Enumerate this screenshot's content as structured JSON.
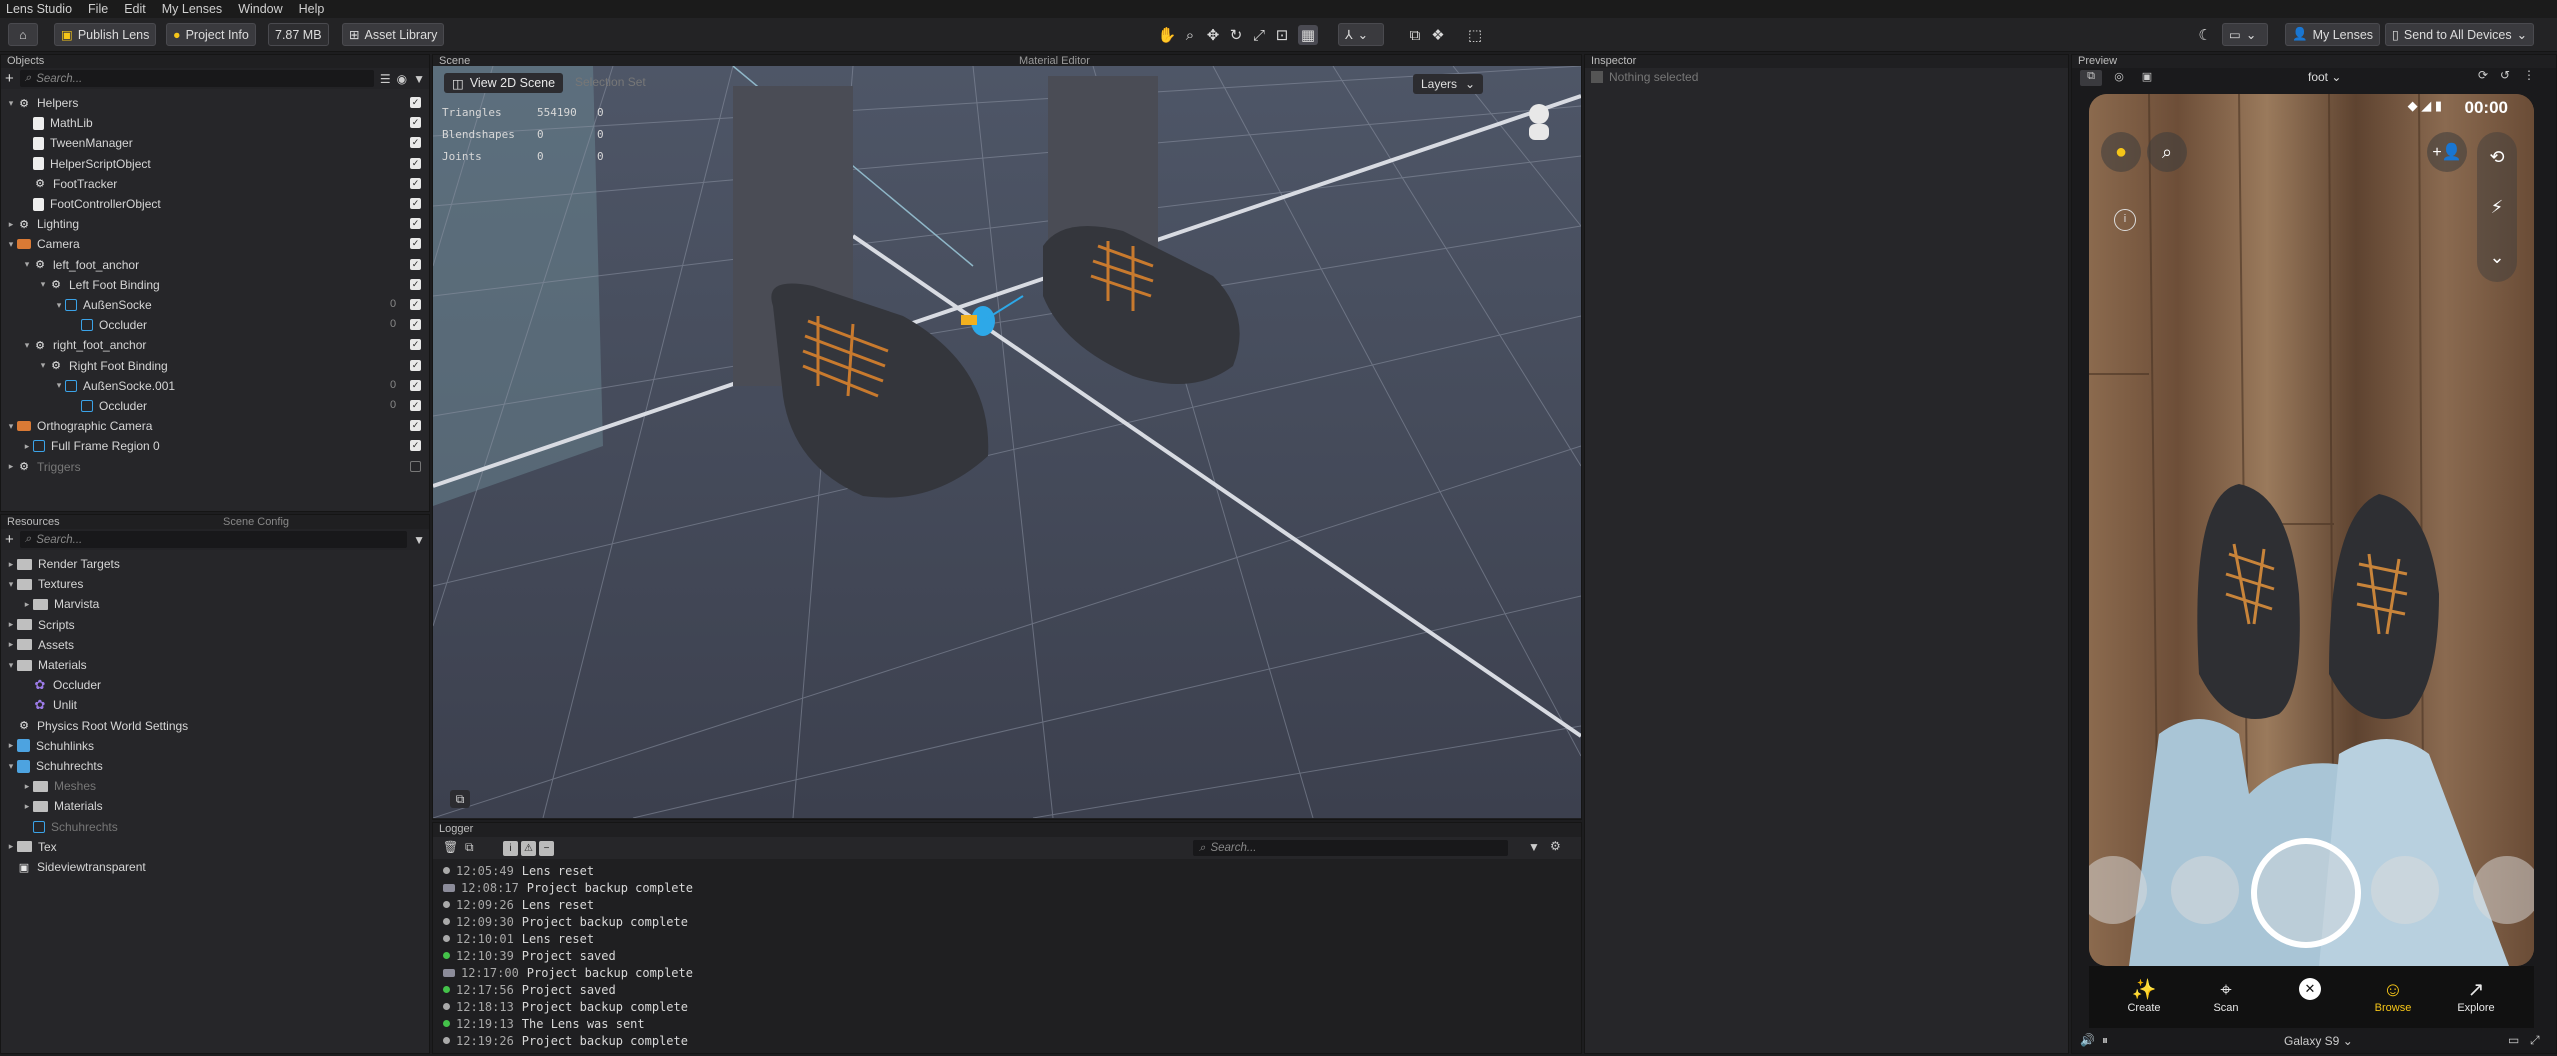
{
  "app_title": "Lens Studio",
  "menu": [
    "File",
    "Edit",
    "My Lenses",
    "Window",
    "Help"
  ],
  "toolbar": {
    "publish": "Publish Lens",
    "project_info": "Project Info",
    "size": "7.87 MB",
    "asset_library": "Asset Library",
    "my_lenses": "My Lenses",
    "send_to_devices": "Send to All Devices"
  },
  "objects_panel": {
    "title": "Objects",
    "search_placeholder": "Search...",
    "items": [
      {
        "label": "Helpers",
        "depth": 0,
        "arrow": "▾",
        "icon": "obj",
        "checked": true
      },
      {
        "label": "MathLib",
        "depth": 1,
        "arrow": "",
        "icon": "script",
        "checked": true
      },
      {
        "label": "TweenManager",
        "depth": 1,
        "arrow": "",
        "icon": "script",
        "checked": true
      },
      {
        "label": "HelperScriptObject",
        "depth": 1,
        "arrow": "",
        "icon": "script",
        "checked": true
      },
      {
        "label": "FootTracker",
        "depth": 1,
        "arrow": "",
        "icon": "obj",
        "checked": true
      },
      {
        "label": "FootControllerObject",
        "depth": 1,
        "arrow": "",
        "icon": "script",
        "checked": true
      },
      {
        "label": "Lighting",
        "depth": 0,
        "arrow": "▸",
        "icon": "obj",
        "checked": true
      },
      {
        "label": "Camera",
        "depth": 0,
        "arrow": "▾",
        "icon": "cam",
        "checked": true
      },
      {
        "label": "left_foot_anchor",
        "depth": 1,
        "arrow": "▾",
        "icon": "obj",
        "checked": true
      },
      {
        "label": "Left Foot Binding",
        "depth": 2,
        "arrow": "▾",
        "icon": "obj",
        "checked": true
      },
      {
        "label": "AußenSocke",
        "depth": 3,
        "arrow": "▾",
        "icon": "mesh",
        "checked": true,
        "count": "0"
      },
      {
        "label": "Occluder",
        "depth": 4,
        "arrow": "",
        "icon": "mesh",
        "checked": true,
        "count": "0"
      },
      {
        "label": "right_foot_anchor",
        "depth": 1,
        "arrow": "▾",
        "icon": "obj",
        "checked": true
      },
      {
        "label": "Right Foot Binding",
        "depth": 2,
        "arrow": "▾",
        "icon": "obj",
        "checked": true
      },
      {
        "label": "AußenSocke.001",
        "depth": 3,
        "arrow": "▾",
        "icon": "mesh",
        "checked": true,
        "count": "0"
      },
      {
        "label": "Occluder",
        "depth": 4,
        "arrow": "",
        "icon": "mesh",
        "checked": true,
        "count": "0"
      },
      {
        "label": "Orthographic Camera",
        "depth": 0,
        "arrow": "▾",
        "icon": "cam",
        "checked": true
      },
      {
        "label": "Full Frame Region 0",
        "depth": 1,
        "arrow": "▸",
        "icon": "frame",
        "checked": true
      },
      {
        "label": "Triggers",
        "depth": 0,
        "arrow": "▸",
        "icon": "obj",
        "checked": false,
        "dim": true
      }
    ]
  },
  "resources_panel": {
    "title": "Resources",
    "tab2": "Scene Config",
    "search_placeholder": "Search...",
    "items": [
      {
        "label": "Render Targets",
        "depth": 0,
        "arrow": "▸",
        "icon": "folder"
      },
      {
        "label": "Textures",
        "depth": 0,
        "arrow": "▾",
        "icon": "folder"
      },
      {
        "label": "Marvista",
        "depth": 1,
        "arrow": "▸",
        "icon": "folder"
      },
      {
        "label": "Scripts",
        "depth": 0,
        "arrow": "▸",
        "icon": "folder"
      },
      {
        "label": "Assets",
        "depth": 0,
        "arrow": "▸",
        "icon": "folder"
      },
      {
        "label": "Materials",
        "depth": 0,
        "arrow": "▾",
        "icon": "folder"
      },
      {
        "label": "Occluder",
        "depth": 1,
        "arrow": "",
        "icon": "mat"
      },
      {
        "label": "Unlit",
        "depth": 1,
        "arrow": "",
        "icon": "mat"
      },
      {
        "label": "Physics Root World Settings",
        "depth": 0,
        "arrow": "",
        "icon": "physics"
      },
      {
        "label": "Schuhlinks",
        "depth": 0,
        "arrow": "▸",
        "icon": "tex"
      },
      {
        "label": "Schuhrechts",
        "depth": 0,
        "arrow": "▾",
        "icon": "tex"
      },
      {
        "label": "Meshes",
        "depth": 1,
        "arrow": "▸",
        "icon": "folder",
        "dim": true
      },
      {
        "label": "Materials",
        "depth": 1,
        "arrow": "▸",
        "icon": "folder"
      },
      {
        "label": "Schuhrechts",
        "depth": 1,
        "arrow": "",
        "icon": "mesh",
        "dim": true
      },
      {
        "label": "Tex",
        "depth": 0,
        "arrow": "▸",
        "icon": "folder"
      },
      {
        "label": "Sideviewtransparent",
        "depth": 0,
        "arrow": "",
        "icon": "image"
      }
    ]
  },
  "scene_panel": {
    "title": "Scene",
    "tab2": "Material Editor",
    "view_2d_button": "View 2D Scene",
    "selection_button": "Selection Set",
    "layers_button": "Layers",
    "stats": [
      {
        "label": "Triangles",
        "a": "554190",
        "b": "0"
      },
      {
        "label": "Blendshapes",
        "a": "0",
        "b": "0"
      },
      {
        "label": "Joints",
        "a": "0",
        "b": "0"
      }
    ]
  },
  "inspector": {
    "title": "Inspector",
    "empty": "Nothing selected"
  },
  "logger": {
    "title": "Logger",
    "search_placeholder": "Search...",
    "lines": [
      {
        "time": "12:05:49",
        "msg": "Lens reset",
        "kind": "info"
      },
      {
        "time": "12:08:17",
        "msg": "Project backup complete",
        "kind": "badge"
      },
      {
        "time": "12:09:26",
        "msg": "Lens reset",
        "kind": "info"
      },
      {
        "time": "12:09:30",
        "msg": "Project backup complete",
        "kind": "info"
      },
      {
        "time": "12:10:01",
        "msg": "Lens reset",
        "kind": "info"
      },
      {
        "time": "12:10:39",
        "msg": "Project saved",
        "kind": "ok"
      },
      {
        "time": "12:17:00",
        "msg": "Project backup complete",
        "kind": "badge"
      },
      {
        "time": "12:17:56",
        "msg": "Project saved",
        "kind": "ok"
      },
      {
        "time": "12:18:13",
        "msg": "Project backup complete",
        "kind": "info"
      },
      {
        "time": "12:19:13",
        "msg": "The Lens was sent",
        "kind": "ok"
      },
      {
        "time": "12:19:26",
        "msg": "Project backup complete",
        "kind": "info"
      }
    ]
  },
  "preview": {
    "title": "Preview",
    "mode": "foot",
    "clock": "00:00",
    "device": "Galaxy S9",
    "nav": [
      {
        "label": "Create",
        "icon": "✨"
      },
      {
        "label": "Scan",
        "icon": "⌖"
      },
      {
        "label": "",
        "icon": "✕"
      },
      {
        "label": "Browse",
        "icon": "☺",
        "active": true
      },
      {
        "label": "Explore",
        "icon": "↗"
      }
    ]
  },
  "colors": {
    "accent": "#f5c518",
    "panel": "#262629",
    "scene": "#3f4352",
    "log_ok": "#44c24a"
  }
}
